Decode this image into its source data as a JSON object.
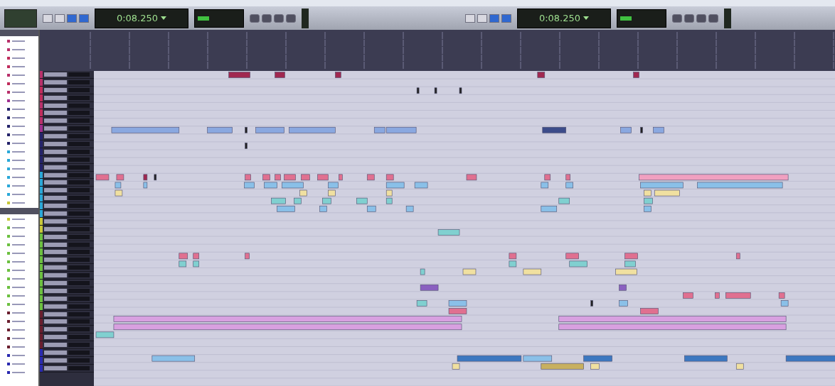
{
  "transport": [
    {
      "counter": "0:08.250"
    },
    {
      "counter": "0:08.250"
    }
  ],
  "tracks": [
    {
      "color": "#b8306a"
    },
    {
      "color": "#b8306a"
    },
    {
      "color": "#c02c5c"
    },
    {
      "color": "#c02c5c"
    },
    {
      "color": "#b8306a"
    },
    {
      "color": "#c02c5c"
    },
    {
      "color": "#b8306a"
    },
    {
      "color": "#a03090"
    },
    {
      "color": "#24236a"
    },
    {
      "color": "#24236a"
    },
    {
      "color": "#24236a"
    },
    {
      "color": "#24236a"
    },
    {
      "color": "#24236a"
    },
    {
      "color": "#2aa8d8"
    },
    {
      "color": "#2aa8d8"
    },
    {
      "color": "#2aa8d8"
    },
    {
      "color": "#2aa8d8"
    },
    {
      "color": "#2aa8d8"
    },
    {
      "color": "#2aa8d8"
    },
    {
      "color": "#c8c83a"
    },
    {
      "color": "#c8c83a"
    },
    {
      "color": "#6cc040"
    },
    {
      "color": "#6cc040"
    },
    {
      "color": "#6cc040"
    },
    {
      "color": "#6cc040"
    },
    {
      "color": "#6cc040"
    },
    {
      "color": "#6cc040"
    },
    {
      "color": "#6cc040"
    },
    {
      "color": "#6cc040"
    },
    {
      "color": "#6cc040"
    },
    {
      "color": "#6cc040"
    },
    {
      "color": "#6a1e2e"
    },
    {
      "color": "#6a1e2e"
    },
    {
      "color": "#6a1e2e"
    },
    {
      "color": "#6a1e2e"
    },
    {
      "color": "#6a1e2e"
    },
    {
      "color": "#2a2ab0"
    },
    {
      "color": "#2a2ab0"
    },
    {
      "color": "#2a2ab0"
    }
  ]
}
